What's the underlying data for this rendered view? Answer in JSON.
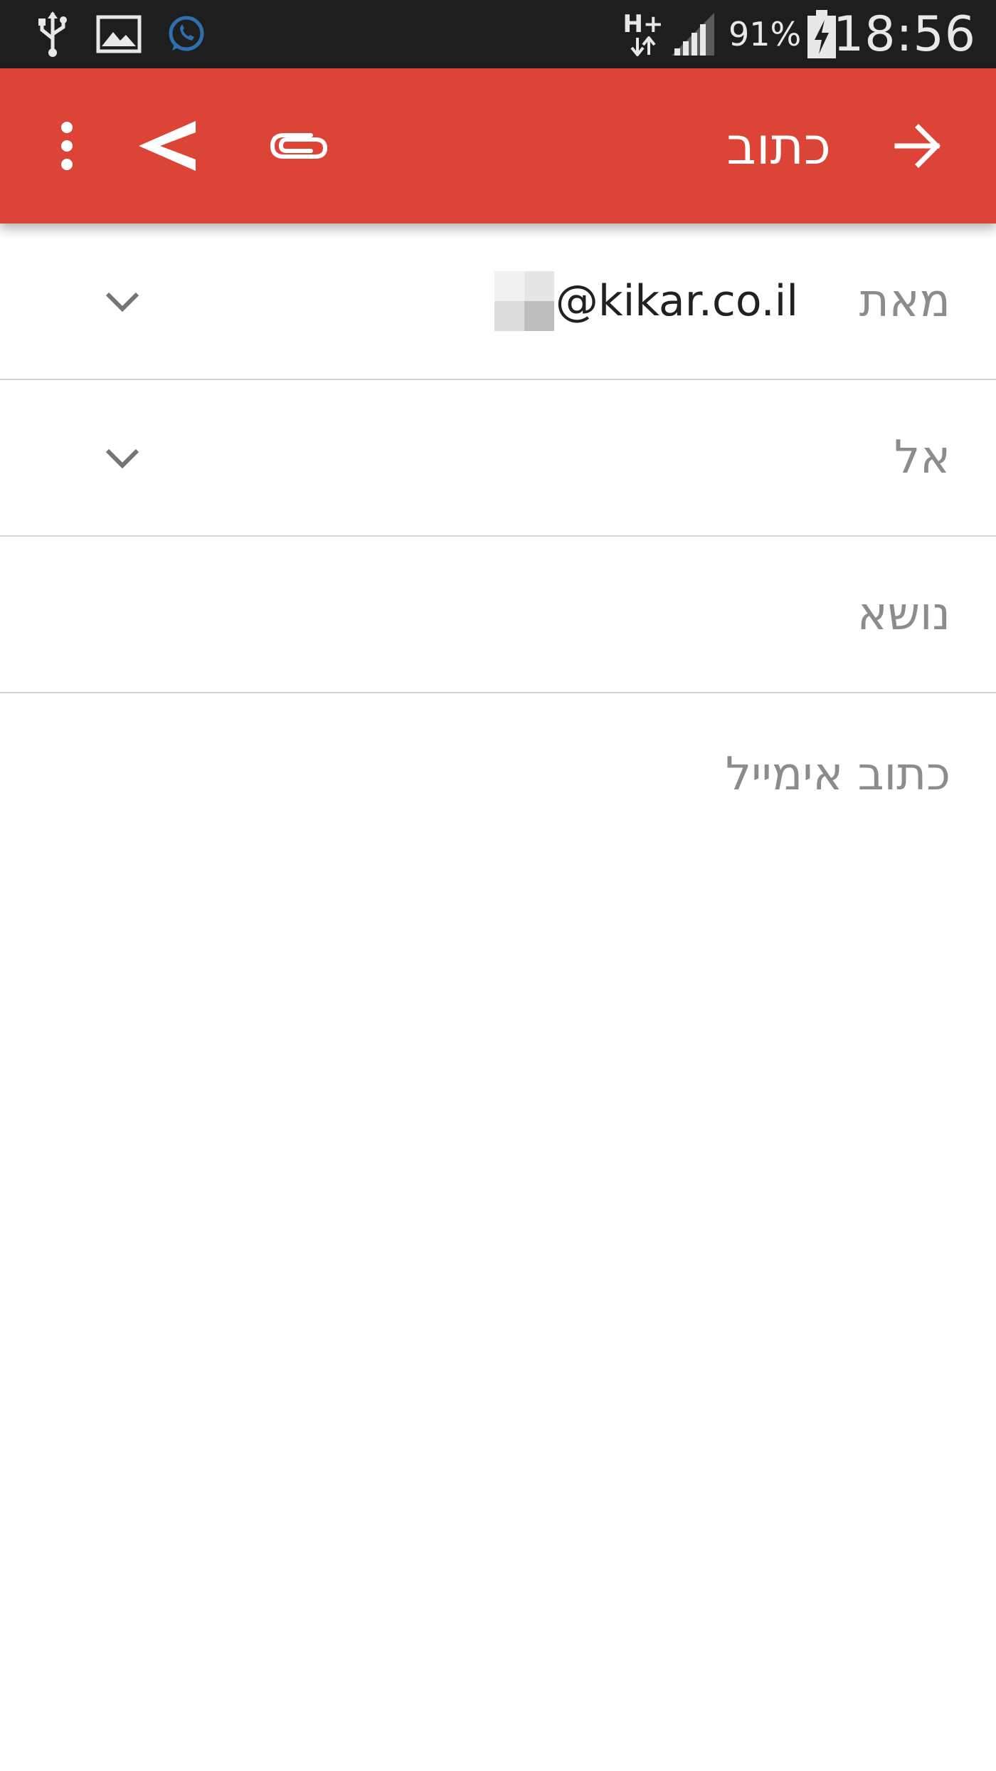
{
  "status_bar": {
    "time": "18:56",
    "battery_percent": "91%",
    "network_type": "H+",
    "icons": [
      "usb-icon",
      "gallery-icon",
      "whatsapp-icon",
      "network-icon",
      "signal-icon",
      "battery-charging-icon"
    ]
  },
  "app_bar": {
    "title": "כתוב",
    "background_color": "#db4437",
    "icons": [
      "back-arrow-icon",
      "attach-icon",
      "send-icon",
      "overflow-menu-icon"
    ]
  },
  "compose": {
    "from_label": "מאת",
    "from_value": "@kikar.co.il",
    "to_label": "אל",
    "subject_placeholder": "נושא",
    "body_placeholder": "כתוב אימייל"
  }
}
